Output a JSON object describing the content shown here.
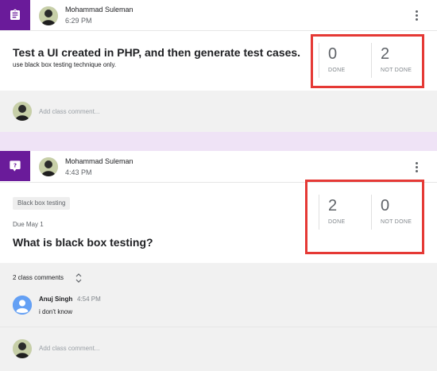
{
  "posts": [
    {
      "type_icon": "assignment-icon",
      "author": "Mohammad Suleman",
      "time": "6:29 PM",
      "title": "Test a UI created in PHP, and then generate test cases.",
      "description": "use black box testing technique only.",
      "stats": {
        "done_count": "0",
        "done_label": "DONE",
        "not_done_count": "2",
        "not_done_label": "NOT DONE"
      },
      "add_comment_placeholder": "Add class comment..."
    },
    {
      "type_icon": "question-icon",
      "author": "Mohammad Suleman",
      "time": "4:43 PM",
      "topic": "Black box testing",
      "due": "Due May 1",
      "title": "What is black box testing?",
      "stats": {
        "done_count": "2",
        "done_label": "DONE",
        "not_done_count": "0",
        "not_done_label": "NOT DONE"
      },
      "comments_toggle": "2 class comments",
      "comment": {
        "author": "Anuj Singh",
        "time": "4:54 PM",
        "text": "i don't know"
      },
      "add_comment_placeholder": "Add class comment..."
    }
  ],
  "colors": {
    "type_badge": "#6a1b9a",
    "highlight": "#e53935",
    "page_background": "#efe3f6",
    "gray_area": "#f1f1f1"
  }
}
